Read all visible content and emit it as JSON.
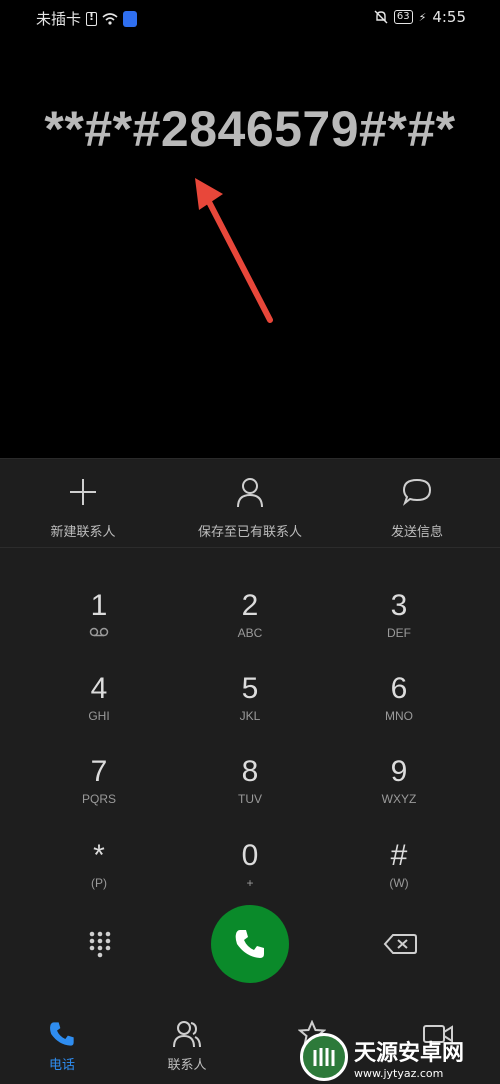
{
  "status_bar": {
    "carrier": "未插卡",
    "battery": "63",
    "time": "4:55"
  },
  "dialer": {
    "number": "**#*#2846579#*#*"
  },
  "actions": [
    {
      "label": "新建联系人",
      "icon": "plus-icon"
    },
    {
      "label": "保存至已有联系人",
      "icon": "person-icon"
    },
    {
      "label": "发送信息",
      "icon": "message-icon"
    }
  ],
  "keys": [
    {
      "digit": "1",
      "letters": ""
    },
    {
      "digit": "2",
      "letters": "ABC"
    },
    {
      "digit": "3",
      "letters": "DEF"
    },
    {
      "digit": "4",
      "letters": "GHI"
    },
    {
      "digit": "5",
      "letters": "JKL"
    },
    {
      "digit": "6",
      "letters": "MNO"
    },
    {
      "digit": "7",
      "letters": "PQRS"
    },
    {
      "digit": "8",
      "letters": "TUV"
    },
    {
      "digit": "9",
      "letters": "WXYZ"
    },
    {
      "digit": "*",
      "letters": "(P)"
    },
    {
      "digit": "0",
      "letters": "+"
    },
    {
      "digit": "#",
      "letters": "(W)"
    }
  ],
  "bottom_nav": [
    {
      "label": "电话",
      "active": true,
      "icon": "phone-icon"
    },
    {
      "label": "联系人",
      "active": false,
      "icon": "contacts-icon"
    }
  ],
  "watermark": {
    "title": "天源安卓网",
    "url": "www.jytyaz.com"
  },
  "colors": {
    "call_button": "#0a8a2a",
    "active_tab": "#2f8df0",
    "annotation_arrow": "#e8473a"
  }
}
